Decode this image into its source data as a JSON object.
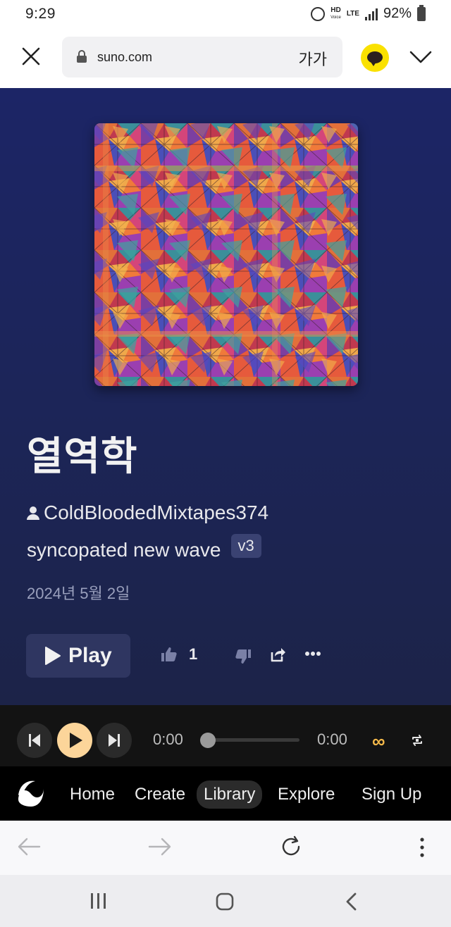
{
  "status_bar": {
    "time": "9:29",
    "hd_label": "HD",
    "voice_label": "Voice",
    "lte_label": "LTE",
    "battery": "92%"
  },
  "browser": {
    "url": "suno.com",
    "text_size_label": "가가"
  },
  "song": {
    "title": "열역학",
    "artist": "ColdBloodedMixtapes374",
    "style": "syncopated new wave",
    "version_badge": "v3",
    "date": "2024년 5월 2일",
    "play_label": "Play",
    "like_count": "1"
  },
  "player": {
    "current_time": "0:00",
    "duration": "0:00",
    "progress": 0
  },
  "site_nav": {
    "items": [
      {
        "label": "Home"
      },
      {
        "label": "Create"
      },
      {
        "label": "Library"
      },
      {
        "label": "Explore"
      },
      {
        "label": "Sign Up"
      }
    ],
    "active": "Library"
  },
  "colors": {
    "background": "#1c2557",
    "accent": "#fcd59a",
    "loop_accent": "#f5b94a",
    "kakao_yellow": "#fae100"
  },
  "icons": {
    "close": "close-icon",
    "lock": "lock-icon",
    "kakao": "kakao-talk-icon",
    "chevron": "chevron-down-icon",
    "user": "user-icon",
    "play": "play-icon",
    "thumbs_up": "thumbs-up-icon",
    "thumbs_down": "thumbs-down-icon",
    "share": "share-icon",
    "more": "more-icon",
    "prev": "skip-previous-icon",
    "next": "skip-next-icon",
    "loop": "infinity-icon",
    "repeat": "repeat-icon"
  }
}
